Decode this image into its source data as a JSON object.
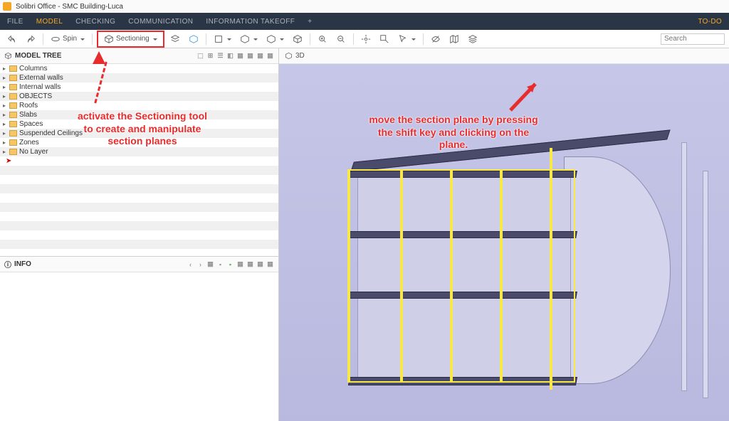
{
  "title": "Solibri Office - SMC Building-Luca",
  "menu": {
    "items": [
      "FILE",
      "MODEL",
      "CHECKING",
      "COMMUNICATION",
      "INFORMATION TAKEOFF"
    ],
    "active_index": 1,
    "todo": "TO-DO"
  },
  "toolbar": {
    "spin": "Spin",
    "sectioning": "Sectioning",
    "search_placeholder": "Search"
  },
  "panels": {
    "model_tree": {
      "title": "MODEL TREE",
      "items": [
        "Columns",
        "External walls",
        "Internal walls",
        "OBJECTS",
        "Roofs",
        "Slabs",
        "Spaces",
        "Suspended Ceilings",
        "Zones",
        "No Layer"
      ]
    },
    "info": {
      "title": "INFO"
    },
    "view3d": {
      "title": "3D"
    }
  },
  "annotations": {
    "left": "activate the Sectioning tool\nto create and manipulate\nsection planes",
    "right": "move the section plane by pressing\nthe shift key and clicking on the\nplane."
  }
}
